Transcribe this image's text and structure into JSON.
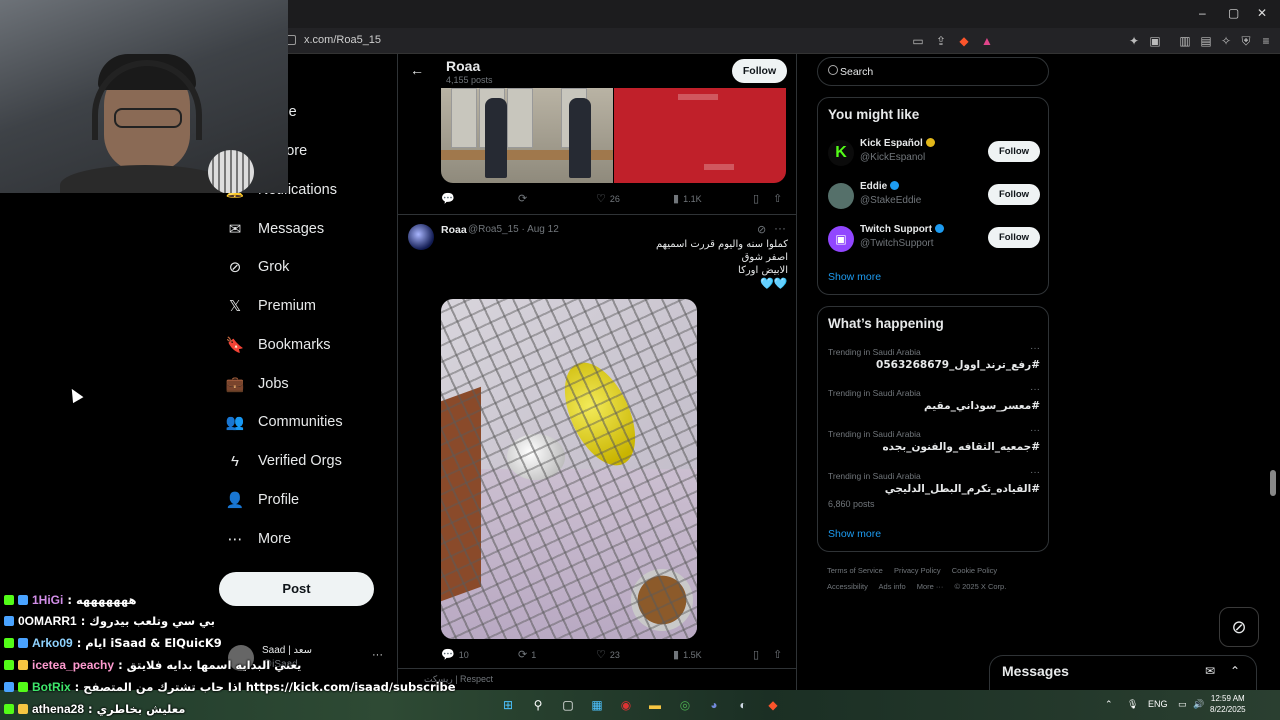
{
  "browser": {
    "url": "x.com/Roa5_15",
    "window_controls": [
      "–",
      "▢",
      "✕"
    ]
  },
  "nav": {
    "items": [
      {
        "label": "Home",
        "icon": "home-icon",
        "glyph": "⌂"
      },
      {
        "label": "Explore",
        "icon": "search-icon",
        "glyph": "⚲"
      },
      {
        "label": "Notifications",
        "icon": "bell-icon",
        "glyph": "🔔"
      },
      {
        "label": "Messages",
        "icon": "mail-icon",
        "glyph": "✉"
      },
      {
        "label": "Grok",
        "icon": "grok-icon",
        "glyph": "⊘"
      },
      {
        "label": "Premium",
        "icon": "x-logo-icon",
        "glyph": "𝕏"
      },
      {
        "label": "Bookmarks",
        "icon": "bookmark-icon",
        "glyph": "🔖"
      },
      {
        "label": "Jobs",
        "icon": "briefcase-icon",
        "glyph": "💼"
      },
      {
        "label": "Communities",
        "icon": "people-icon",
        "glyph": "👥"
      },
      {
        "label": "Verified Orgs",
        "icon": "lightning-icon",
        "glyph": "ϟ"
      },
      {
        "label": "Profile",
        "icon": "person-icon",
        "glyph": "👤"
      },
      {
        "label": "More",
        "icon": "more-circle-icon",
        "glyph": "⋯"
      }
    ],
    "post_label": "Post",
    "account": {
      "name": "Saad | سعد",
      "handle": "@iSaad",
      "more": "···"
    }
  },
  "profile_header": {
    "name": "Roaa",
    "posts_count": "4,155 posts",
    "follow_label": "Follow"
  },
  "prev_tweet_actions": {
    "replies": "",
    "reposts": "",
    "likes": "26",
    "views": "1.1K"
  },
  "tweet": {
    "author": "Roaa",
    "handle_date": "@Roa5_15 · Aug 12",
    "text": "كملوا سنه واليوم قررت اسميهم\nاصفر شوق\nالابيض اوركا",
    "emoji": "🩵🩵",
    "actions": {
      "replies": "10",
      "reposts": "1",
      "likes": "23",
      "views": "1.5K"
    }
  },
  "next_tweet_repost_line": "ريسكت | Respect",
  "search": {
    "placeholder": "Search"
  },
  "you_might_like": {
    "title": "You might like",
    "accounts": [
      {
        "name": "Kick Español",
        "handle": "@KickEspanol",
        "follow": "Follow",
        "color": "#0b0b0b"
      },
      {
        "name": "Eddie",
        "handle": "@StakeEddie",
        "follow": "Follow",
        "color": "#55706a"
      },
      {
        "name": "Twitch Support",
        "handle": "@TwitchSupport",
        "follow": "Follow",
        "color": "#9146ff"
      }
    ],
    "show_more": "Show more"
  },
  "whats_happening": {
    "title": "What’s happening",
    "trends": [
      {
        "context": "Trending in Saudi Arabia",
        "tag": "#رفع_ترند_اوول_0563268679",
        "count": ""
      },
      {
        "context": "Trending in Saudi Arabia",
        "tag": "#معسر_سوداني_مقيم",
        "count": ""
      },
      {
        "context": "Trending in Saudi Arabia",
        "tag": "#جمعيه_الثقافه_والفنون_بجده",
        "count": ""
      },
      {
        "context": "Trending in Saudi Arabia",
        "tag": "#القياده_تكرم_البطل_الدليجي",
        "count": "6,860 posts"
      }
    ],
    "show_more": "Show more"
  },
  "footer": {
    "links": [
      "Terms of Service",
      "Privacy Policy",
      "Cookie Policy",
      "Accessibility",
      "Ads info",
      "More ···",
      "© 2025 X Corp."
    ]
  },
  "messages_drawer": {
    "title": "Messages"
  },
  "chat": [
    {
      "user": "1HiGi",
      "msg": ": هههههههه",
      "color": "#d28ee8"
    },
    {
      "user": "0OMARR1",
      "msg": ": بي سي وتلعب بيدروك",
      "color": "#ffffff"
    },
    {
      "user": "Arko09",
      "msg": ": ايام iSaad & ElQuicK9",
      "color": "#8fd3ff"
    },
    {
      "user": "icetea_peachy",
      "msg": ": يعني البدايه اسمها بدايه فلايتق",
      "color": "#ff9bd0"
    },
    {
      "user": "BotRix",
      "msg": ": اذا حاب تشترك من المتصفح https://kick.com/isaad/subscribe",
      "color": "#3ee66b"
    },
    {
      "user": "athena28",
      "msg": ": معليش بخاطري",
      "color": "#ffffff"
    }
  ],
  "taskbar": {
    "lang": "ENG",
    "time": "12:59 AM",
    "date": "8/22/2025"
  }
}
